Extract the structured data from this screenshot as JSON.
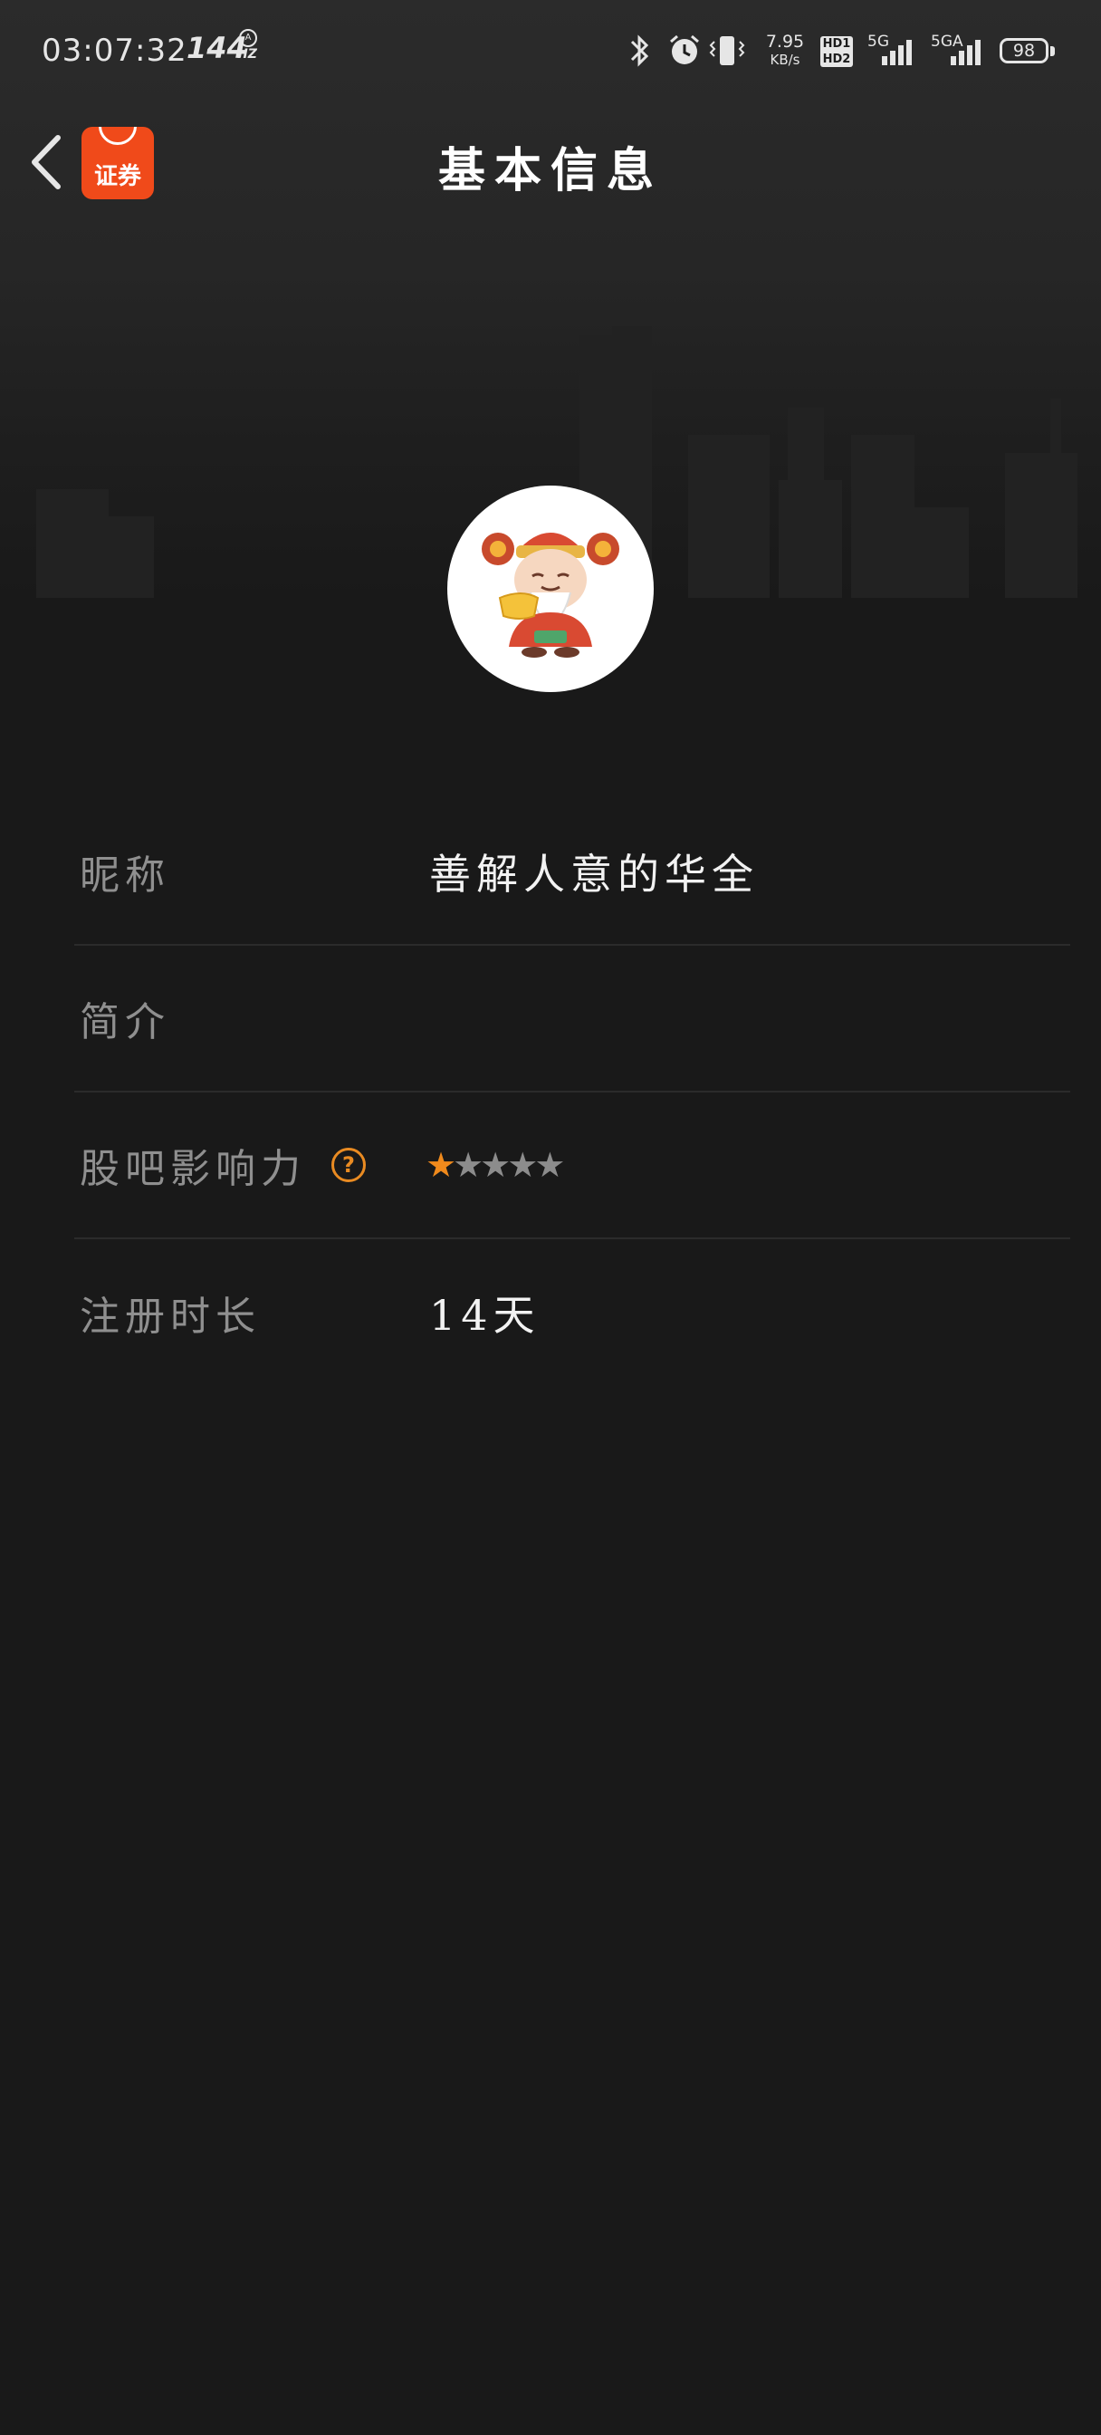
{
  "status_bar": {
    "time": "03:07:32",
    "refresh_rate": "144",
    "refresh_unit": "HZ",
    "net_speed_value": "7.95",
    "net_speed_unit": "KB/s",
    "hd_top": "HD1",
    "hd_bottom": "HD2",
    "sim1_label": "5G",
    "sim2_label": "5GA",
    "battery": "98",
    "icons": [
      "bluetooth-icon",
      "alarm-icon",
      "vibrate-icon"
    ]
  },
  "header": {
    "title": "基本信息",
    "app_logo_text": "证券",
    "back_icon": "chevron-left-icon"
  },
  "profile": {
    "rows": [
      {
        "label": "昵称",
        "value": "善解人意的华全"
      },
      {
        "label": "简介",
        "value": ""
      },
      {
        "label": "股吧影响力",
        "help": "?",
        "rating": 1,
        "rating_max": 5
      },
      {
        "label": "注册时长",
        "value": "14天"
      }
    ]
  },
  "colors": {
    "background": "#191919",
    "accent": "#f08a1c",
    "logo": "#f04a1a",
    "label": "#8f8f8f",
    "value": "#f2f2f2"
  }
}
